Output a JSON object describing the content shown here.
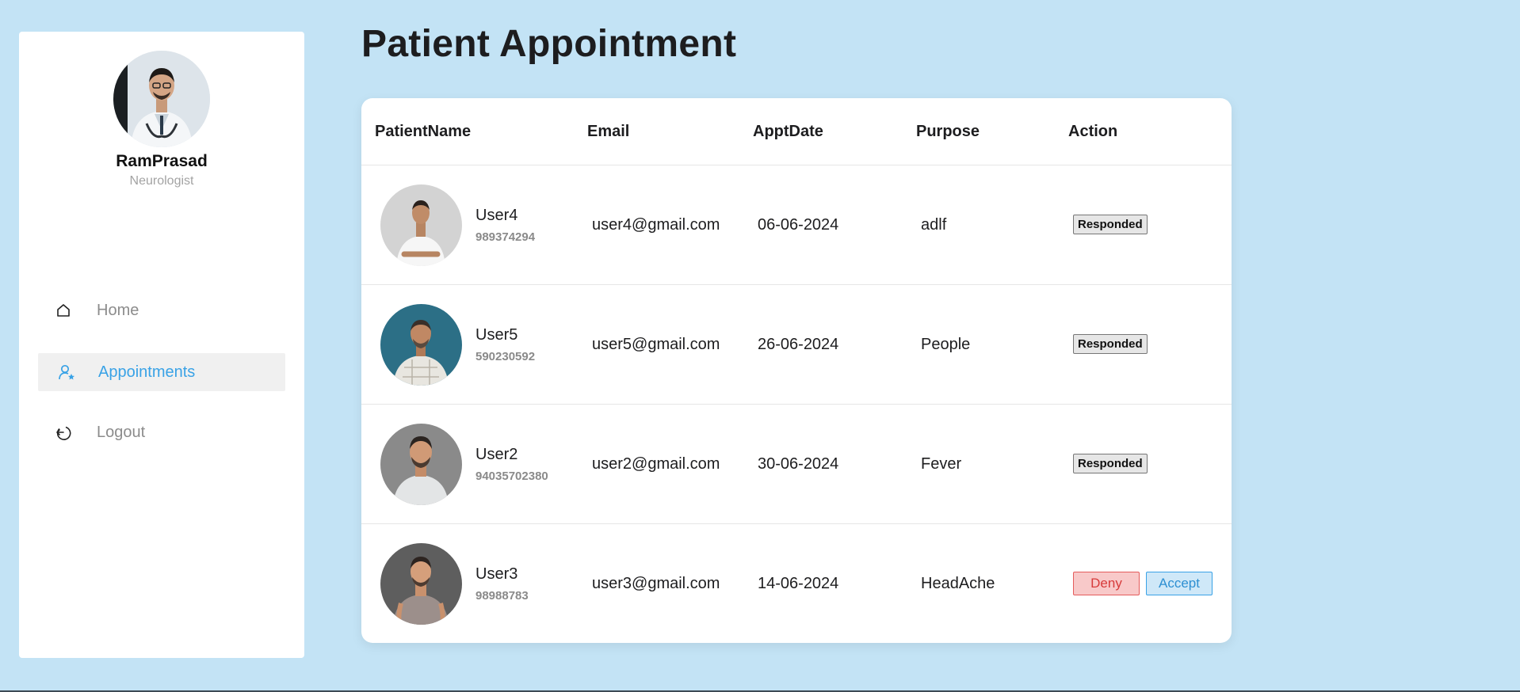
{
  "sidebar": {
    "doctor_name": "RamPrasad",
    "doctor_specialty": "Neurologist",
    "nav": [
      {
        "label": "Home",
        "icon": "home-icon",
        "active": false
      },
      {
        "label": "Appointments",
        "icon": "user-star-icon",
        "active": true
      },
      {
        "label": "Logout",
        "icon": "logout-icon",
        "active": false
      }
    ]
  },
  "main": {
    "title": "Patient Appointment",
    "columns": {
      "name": "PatientName",
      "email": "Email",
      "date": "ApptDate",
      "purpose": "Purpose",
      "action": "Action"
    },
    "rows": [
      {
        "name": "User4",
        "phone": "989374294",
        "email": "user4@gmail.com",
        "date": "06-06-2024",
        "purpose": "adlf",
        "status": "Responded"
      },
      {
        "name": "User5",
        "phone": "590230592",
        "email": "user5@gmail.com",
        "date": "26-06-2024",
        "purpose": "People",
        "status": "Responded"
      },
      {
        "name": "User2",
        "phone": "94035702380",
        "email": "user2@gmail.com",
        "date": "30-06-2024",
        "purpose": "Fever",
        "status": "Responded"
      },
      {
        "name": "User3",
        "phone": "98988783",
        "email": "user3@gmail.com",
        "date": "14-06-2024",
        "purpose": "HeadAche",
        "deny_label": "Deny",
        "accept_label": "Accept"
      }
    ]
  },
  "colors": {
    "background": "#c3e3f5",
    "accent": "#39a2e6",
    "deny": "#d73b3b"
  }
}
